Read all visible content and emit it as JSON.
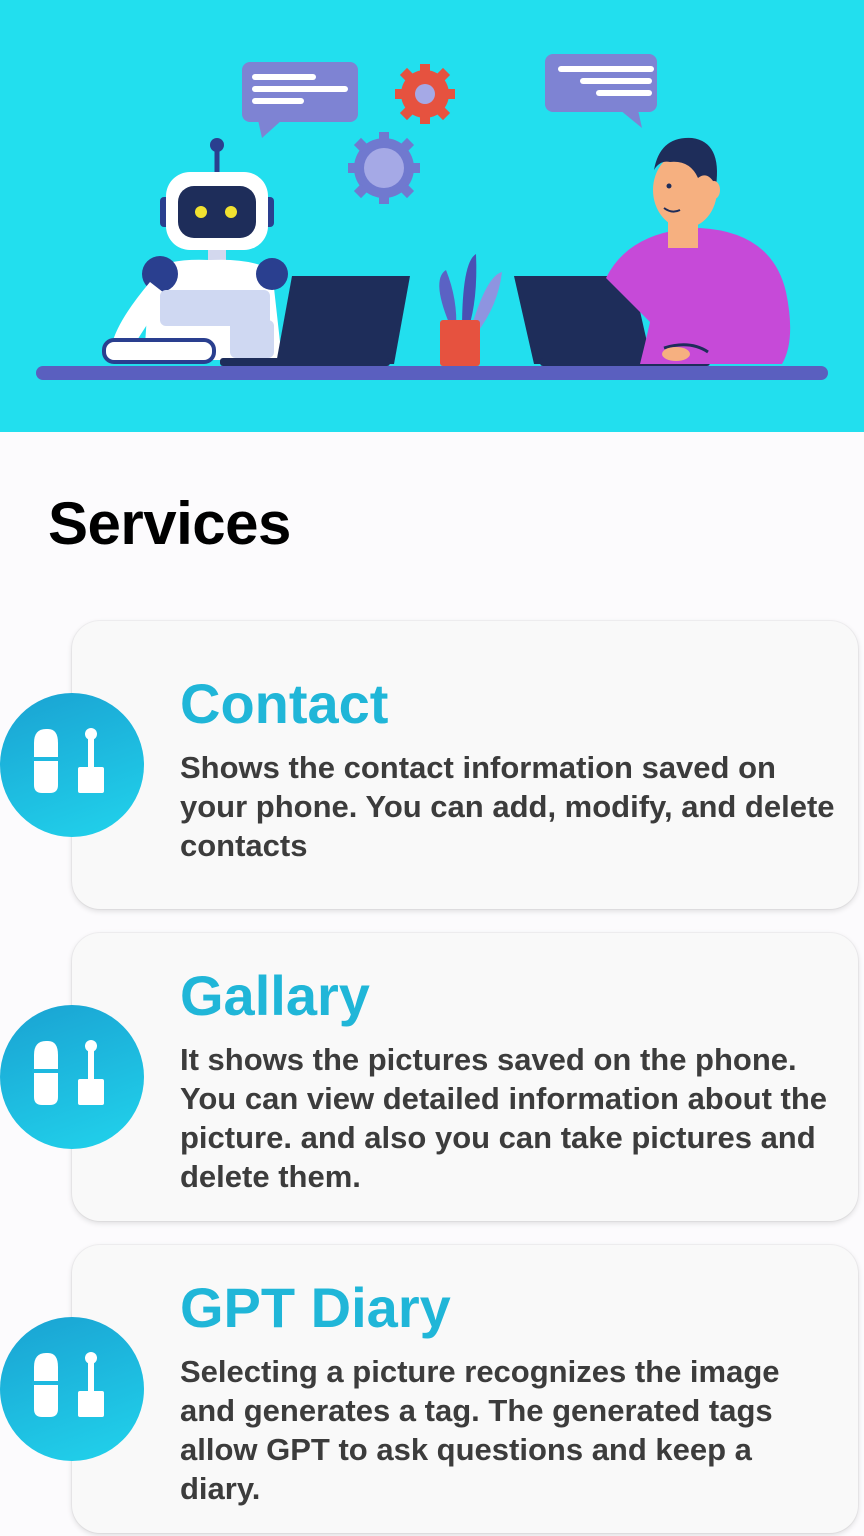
{
  "header": {
    "illustration": "robot-and-person-at-laptops-illustration"
  },
  "section": {
    "title": "Services"
  },
  "services": [
    {
      "title": "Contact",
      "description": "Shows the contact information saved on your phone. You can add, modify, and delete contacts",
      "icon": "service-icon"
    },
    {
      "title": "Gallary",
      "description": "It shows the pictures saved on the phone. You can view detailed information about the picture. and also you can take pictures and delete them.",
      "icon": "service-icon"
    },
    {
      "title": "GPT Diary",
      "description": "Selecting a picture recognizes the image and generates a tag. The generated tags allow GPT to ask questions and keep a diary.",
      "icon": "service-icon"
    }
  ],
  "colors": {
    "hero_background": "#22dfee",
    "accent_title": "#20b6d8",
    "card_background": "#f9f9f9",
    "page_background": "#fcfbfd"
  }
}
